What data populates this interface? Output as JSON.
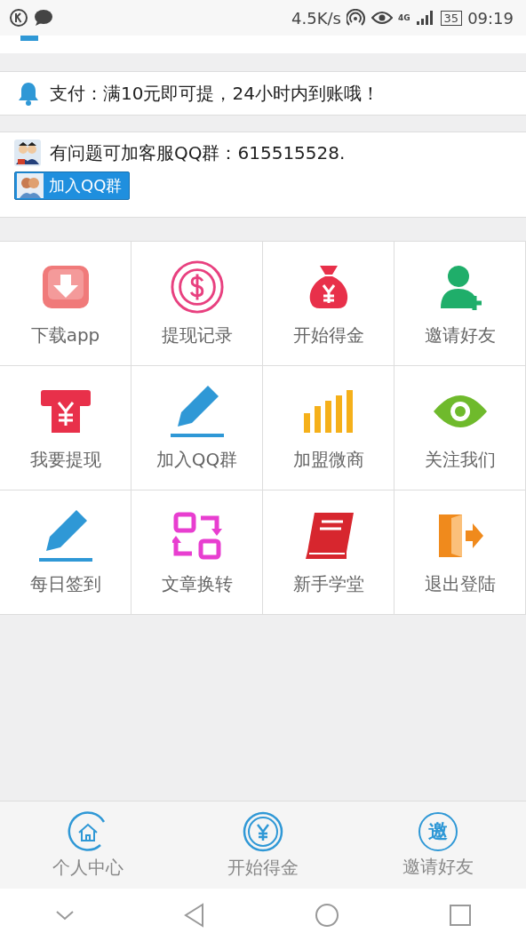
{
  "status_bar": {
    "speed": "4.5K/s",
    "network": "4G",
    "battery": "35",
    "time": "09:19"
  },
  "notice": {
    "text": "支付：满10元即可提，24小时内到账哦！"
  },
  "qq": {
    "text": "有问题可加客服QQ群：615515528.",
    "button": "加入QQ群"
  },
  "grid": [
    {
      "label": "下载app",
      "kind": "download"
    },
    {
      "label": "提现记录",
      "kind": "dollar"
    },
    {
      "label": "开始得金",
      "kind": "moneybag"
    },
    {
      "label": "邀请好友",
      "kind": "adduser"
    },
    {
      "label": "我要提现",
      "kind": "atm"
    },
    {
      "label": "加入QQ群",
      "kind": "pen"
    },
    {
      "label": "加盟微商",
      "kind": "bars"
    },
    {
      "label": "关注我们",
      "kind": "eye"
    },
    {
      "label": "每日签到",
      "kind": "pen"
    },
    {
      "label": "文章换转",
      "kind": "swap"
    },
    {
      "label": "新手学堂",
      "kind": "book"
    },
    {
      "label": "退出登陆",
      "kind": "exit"
    }
  ],
  "bottom_nav": [
    {
      "label": "个人中心",
      "kind": "home"
    },
    {
      "label": "开始得金",
      "kind": "yen"
    },
    {
      "label": "邀请好友",
      "kind": "glyph",
      "glyph": "邀"
    }
  ]
}
